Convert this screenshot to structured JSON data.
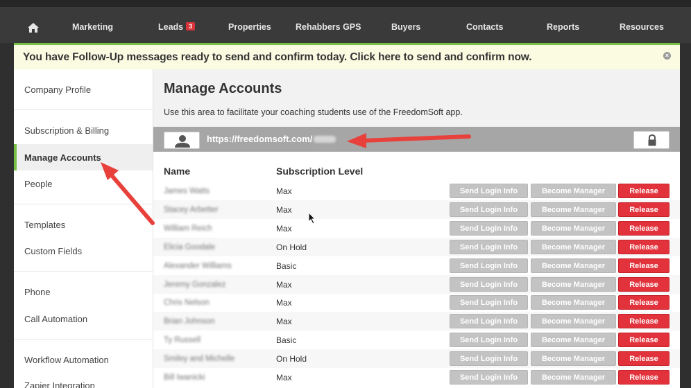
{
  "nav": {
    "items": [
      "Marketing",
      "Leads",
      "Properties",
      "Rehabbers GPS",
      "Buyers",
      "Contacts",
      "Reports",
      "Resources"
    ],
    "leads_badge": "3"
  },
  "banner": {
    "text": "You have Follow-Up messages ready to send and confirm today. Click here to send and confirm now.",
    "close": "×"
  },
  "sidebar": {
    "items": [
      "Company Profile",
      "Subscription & Billing",
      "Manage Accounts",
      "People",
      "Templates",
      "Custom Fields",
      "Phone",
      "Call Automation",
      "Workflow Automation",
      "Zapier Integration"
    ],
    "active": "Manage Accounts"
  },
  "main": {
    "title": "Manage Accounts",
    "description": "Use this area to facilitate your coaching students use of the FreedomSoft app.",
    "url": "https://freedomsoft.com/"
  },
  "table": {
    "headers": [
      "Name",
      "Subscription Level"
    ],
    "buttons": {
      "send": "Send Login Info",
      "manager": "Become Manager",
      "release": "Release"
    },
    "rows": [
      {
        "name": "James Watts",
        "level": "Max"
      },
      {
        "name": "Stacey Arbetter",
        "level": "Max"
      },
      {
        "name": "William Reich",
        "level": "Max"
      },
      {
        "name": "Elicia Goodale",
        "level": "On Hold"
      },
      {
        "name": "Alexander Williams",
        "level": "Basic"
      },
      {
        "name": "Jeremy Gonzalez",
        "level": "Max"
      },
      {
        "name": "Chris Nelson",
        "level": "Max"
      },
      {
        "name": "Brian Johnson",
        "level": "Max"
      },
      {
        "name": "Ty Russell",
        "level": "Basic"
      },
      {
        "name": "Smiley and Michelle",
        "level": "On Hold"
      },
      {
        "name": "Bill Iwanicki",
        "level": "Max"
      }
    ]
  },
  "colors": {
    "accent": "#76c043",
    "release": "#e2333c",
    "arrow": "#e8413c",
    "nav": "#3a3a3a"
  }
}
